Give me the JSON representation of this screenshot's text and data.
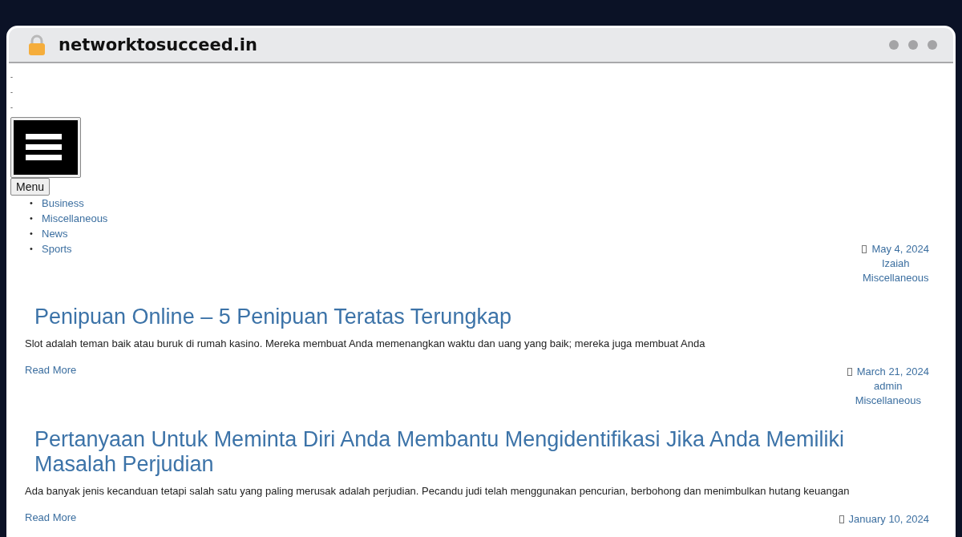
{
  "browser": {
    "url": "networktosucceed.in"
  },
  "top_marks": [
    "-",
    "-",
    "-"
  ],
  "menu_button": {
    "label": "Menu"
  },
  "nav": [
    {
      "bullet": "•",
      "label": "Business"
    },
    {
      "bullet": "•",
      "label": "Miscellaneous"
    },
    {
      "bullet": "•",
      "label": "News"
    },
    {
      "bullet": "•",
      "label": "Sports"
    }
  ],
  "posts": [
    {
      "date": "May 4, 2024",
      "author": "Izaiah",
      "category": "Miscellaneous",
      "title": "Penipuan Online – 5 Penipuan Teratas Terungkap",
      "excerpt": "Slot adalah teman baik atau buruk di rumah kasino. Mereka membuat Anda memenangkan waktu dan uang yang baik; mereka juga membuat Anda",
      "read_more": "Read More"
    },
    {
      "date": "March 21, 2024",
      "author": "admin",
      "category": "Miscellaneous",
      "title": "Pertanyaan Untuk Meminta Diri Anda Membantu Mengidentifikasi Jika Anda Memiliki Masalah Perjudian",
      "excerpt": "Ada banyak jenis kecanduan tetapi salah satu yang paling merusak adalah perjudian. Pecandu judi telah menggunakan pencurian, berbohong dan menimbulkan hutang keuangan",
      "read_more": "Read More"
    },
    {
      "date": "January 10, 2024"
    }
  ]
}
